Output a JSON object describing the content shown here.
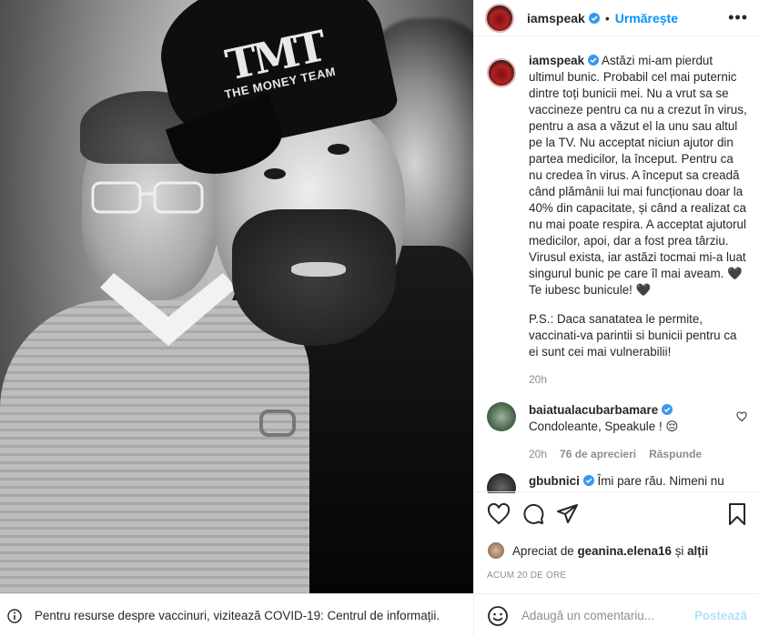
{
  "post": {
    "username": "iamspeak",
    "follow_label": "Urmărește",
    "more_label": "•••",
    "dot": "•"
  },
  "photo": {
    "cap_logo_big": "TMT",
    "cap_logo_small": "THE MONEY TEAM"
  },
  "caption": {
    "username": "iamspeak",
    "text": "Astăzi mi-am pierdut ultimul bunic. Probabil cel mai puternic dintre toți bunicii mei. Nu a vrut sa se vaccineze pentru ca nu a crezut în virus, pentru a asa a văzut el la unu sau altul pe la TV. Nu acceptat niciun ajutor din partea medicilor, la început. Pentru ca nu credea în virus. A început sa creadă când plămânii lui mai funcționau doar la 40% din capacitate, și când a realizat ca nu mai poate respira. A acceptat ajutorul medicilor, apoi, dar a fost prea târziu. Virusul exista, iar astăzi tocmai mi-a luat singurul bunic pe care îl mai aveam. 🖤 Te iubesc bunicule! 🖤",
    "ps": "P.S.: Daca sanatatea le permite, vaccinati-va parintii si bunicii pentru ca ei sunt cei mai vulnerabilii!",
    "time": "20h"
  },
  "comments": [
    {
      "username": "baiatualacubarbamare",
      "text": "Condoleante, Speakule ! 😔",
      "time": "20h",
      "likes": "76 de aprecieri",
      "reply": "Răspunde"
    },
    {
      "username": "gbubnici",
      "text": "Îmi pare rău. Nimeni nu"
    }
  ],
  "likes": {
    "prefix": "Apreciat de",
    "user": "geanina.elena16",
    "conj": "și",
    "others": "alții"
  },
  "ago": "ACUM 20 DE ORE",
  "add_comment": {
    "placeholder": "Adaugă un comentariu...",
    "post_label": "Postează"
  },
  "banner": {
    "text": "Pentru resurse despre vaccinuri, vizitează COVID-19: Centrul de informații."
  },
  "icons": [
    "heart-icon",
    "comment-icon",
    "share-icon",
    "bookmark-icon",
    "emoji-icon",
    "info-icon",
    "verified-icon",
    "more-icon"
  ],
  "colors": {
    "accent": "#0095f6",
    "post_disabled": "#b2dffc",
    "muted": "#8e8e8e",
    "text": "#262626"
  }
}
